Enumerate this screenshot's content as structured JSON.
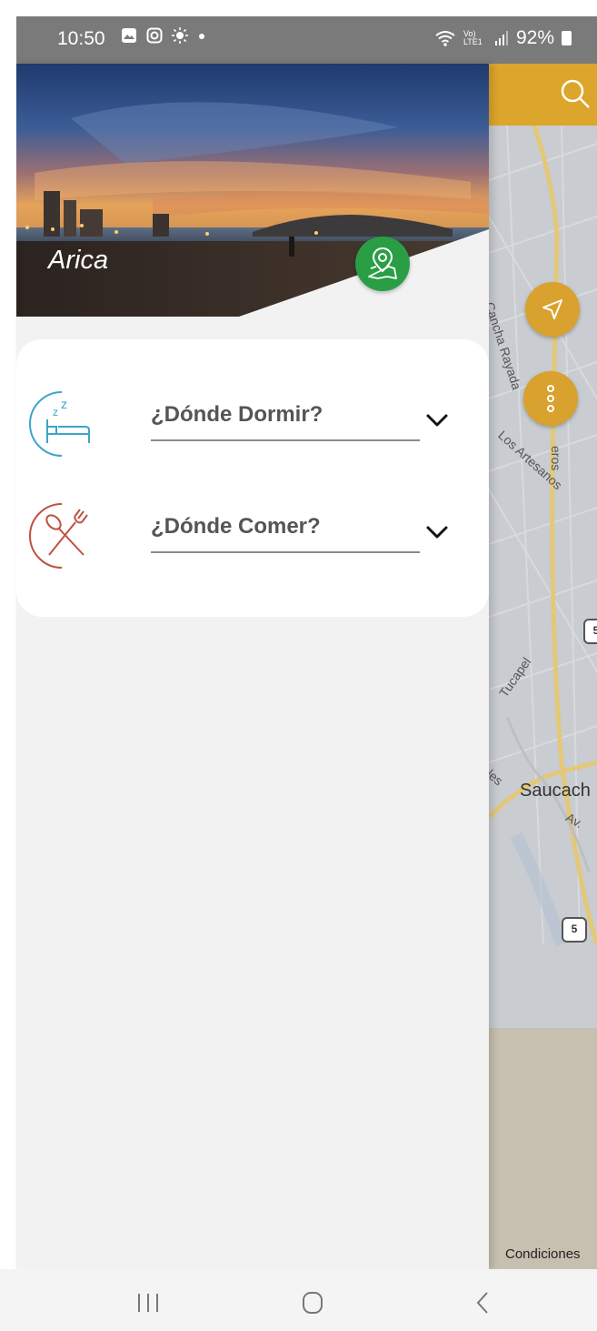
{
  "status_bar": {
    "time": "10:50",
    "battery": "92%",
    "network": "Vo) LTE1",
    "icons": [
      "gallery-icon",
      "instagram-icon",
      "brightness-icon",
      "dot-icon",
      "wifi-icon",
      "signal-icon",
      "battery-icon"
    ]
  },
  "drawer": {
    "city_name": "Arica",
    "map_button_icon": "map-pin-icon",
    "menu": [
      {
        "label": "¿Dónde Dormir?",
        "icon": "bed-sleep-icon",
        "chevron": "chevron-down-icon"
      },
      {
        "label": "¿Dónde Comer?",
        "icon": "spoon-fork-icon",
        "chevron": "chevron-down-icon"
      }
    ]
  },
  "map": {
    "search_icon": "search-icon",
    "labels": [
      "Cancha Rayada",
      "Los Artesanos",
      "eros",
      "Tucapel",
      "tales",
      "Saucach",
      "Av."
    ],
    "route_shields": [
      "5",
      "5"
    ],
    "footer_text": "Condiciones"
  },
  "nav_bar": {
    "icons": [
      "recent-apps-icon",
      "home-icon",
      "back-icon"
    ]
  },
  "colors": {
    "accent_gold": "#dca52b",
    "map_button_green": "#2a9e45",
    "sleep_icon_blue": "#3ba6c9",
    "eat_icon_red": "#c0503f",
    "label_gray": "#555555"
  }
}
